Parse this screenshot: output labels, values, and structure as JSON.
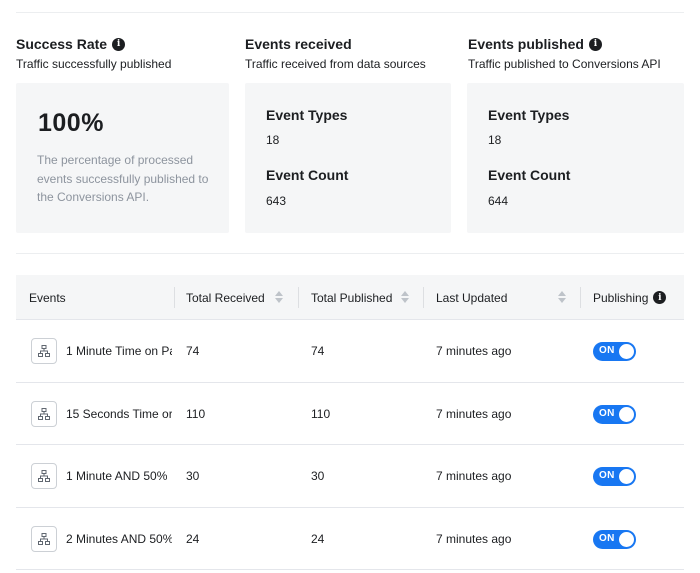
{
  "summary": {
    "success_rate": {
      "title": "Success Rate",
      "subtitle": "Traffic successfully published",
      "value": "100%",
      "description": "The percentage of processed events successfully published to the Conversions API."
    },
    "events_received": {
      "title": "Events received",
      "subtitle": "Traffic received from data sources",
      "types_label": "Event Types",
      "types_value": "18",
      "count_label": "Event Count",
      "count_value": "643"
    },
    "events_published": {
      "title": "Events published",
      "subtitle": "Traffic published to Conversions API",
      "types_label": "Event Types",
      "types_value": "18",
      "count_label": "Event Count",
      "count_value": "644"
    }
  },
  "table": {
    "headers": {
      "events": "Events",
      "total_received": "Total Received",
      "total_published": "Total Published",
      "last_updated": "Last Updated",
      "publishing": "Publishing"
    },
    "rows": [
      {
        "name": "1 Minute Time on Pa",
        "received": "74",
        "published": "74",
        "updated": "7 minutes ago",
        "toggle": "ON"
      },
      {
        "name": "15 Seconds Time or",
        "received": "110",
        "published": "110",
        "updated": "7 minutes ago",
        "toggle": "ON"
      },
      {
        "name": "1 Minute AND 50%",
        "received": "30",
        "published": "30",
        "updated": "7 minutes ago",
        "toggle": "ON"
      },
      {
        "name": "2 Minutes AND 50%",
        "received": "24",
        "published": "24",
        "updated": "7 minutes ago",
        "toggle": "ON"
      }
    ]
  },
  "colors": {
    "accent": "#1877f2",
    "card_bg": "#f5f6f7",
    "muted_text": "#8d949e"
  },
  "icons": {
    "info": "info-icon",
    "event": "event-hierarchy-icon",
    "sort": "sort-icon"
  }
}
